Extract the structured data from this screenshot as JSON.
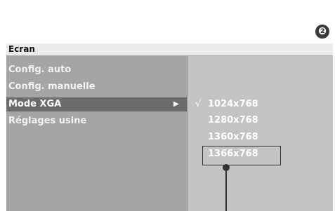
{
  "step_badge": "❷",
  "screen": {
    "title": "Ecran",
    "menu": [
      {
        "label": "Config. auto"
      },
      {
        "label": "Config. manuelle"
      },
      {
        "label": "Mode XGA",
        "selected": true,
        "arrow": "▶"
      },
      {
        "label": "Réglages usine"
      }
    ],
    "check_mark": "√",
    "options": [
      {
        "label": "1024x768",
        "checked": true
      },
      {
        "label": "1280x768"
      },
      {
        "label": "1360x768"
      },
      {
        "label": "1366x768",
        "highlighted": true
      }
    ]
  }
}
